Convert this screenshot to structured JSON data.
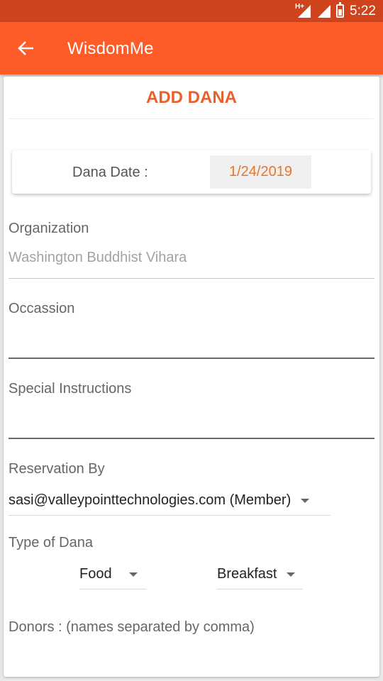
{
  "status": {
    "time": "5:22",
    "network_label": "H+"
  },
  "appbar": {
    "title": "WisdomMe"
  },
  "form": {
    "title": "ADD DANA",
    "dana_date_label": "Dana Date :",
    "dana_date_value": "1/24/2019",
    "organization_label": "Organization",
    "organization_value": "Washington Buddhist Vihara",
    "occasion_label": "Occassion",
    "occasion_value": "",
    "special_instructions_label": "Special Instructions",
    "special_instructions_value": "",
    "reservation_by_label": "Reservation By",
    "reservation_by_value": "sasi@valleypointtechnologies.com (Member)",
    "type_of_dana_label": "Type of Dana",
    "type_value": "Food",
    "meal_value": "Breakfast",
    "donors_label": "Donors : (names separated by comma)"
  },
  "colors": {
    "status_bar": "#cf431d",
    "app_bar": "#fd5c28",
    "accent": "#e8612c",
    "date_text": "#e8752c"
  },
  "icons": {
    "back": "arrow-left-icon",
    "signal": "signal-icon",
    "battery": "battery-icon",
    "dropdown": "chevron-down-icon"
  }
}
